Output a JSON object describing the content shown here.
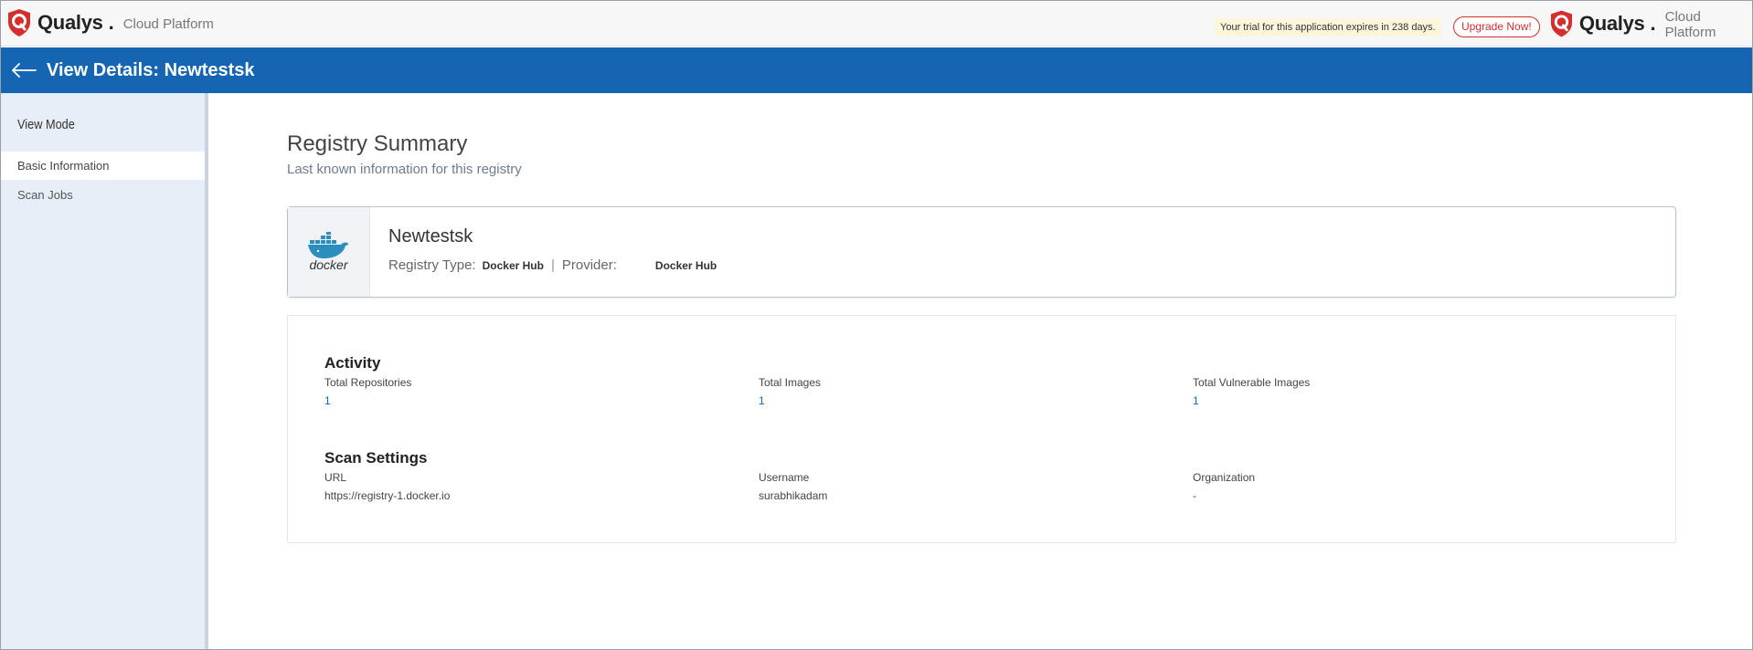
{
  "topbar": {
    "brand_name": "Qualys",
    "brand_dot": ".",
    "brand_sub": "Cloud Platform",
    "trial_notice": "Your trial for this application expires in 238 days.",
    "upgrade_label": "Upgrade Now!",
    "brand_color": "#d32f2f"
  },
  "header": {
    "title": "View Details: Newtestsk",
    "background": "#1565b3"
  },
  "sidebar": {
    "heading": "View Mode",
    "items": [
      {
        "label": "Basic Information",
        "active": true
      },
      {
        "label": "Scan Jobs",
        "active": false
      }
    ]
  },
  "summary": {
    "title": "Registry Summary",
    "subtitle": "Last known information for this registry"
  },
  "registry": {
    "logo_text": "docker",
    "name": "Newtestsk",
    "type_label": "Registry Type:",
    "type_value": "Docker Hub",
    "separator": "|",
    "provider_label": "Provider:",
    "provider_value": "Docker Hub"
  },
  "activity": {
    "title": "Activity",
    "fields": [
      {
        "label": "Total Repositories",
        "value": "1"
      },
      {
        "label": "Total Images",
        "value": "1"
      },
      {
        "label": "Total Vulnerable Images",
        "value": "1"
      }
    ]
  },
  "scan_settings": {
    "title": "Scan Settings",
    "fields": [
      {
        "label": "URL",
        "value": "https://registry-1.docker.io"
      },
      {
        "label": "Username",
        "value": "surabhikadam"
      },
      {
        "label": "Organization",
        "value": "-"
      }
    ]
  }
}
